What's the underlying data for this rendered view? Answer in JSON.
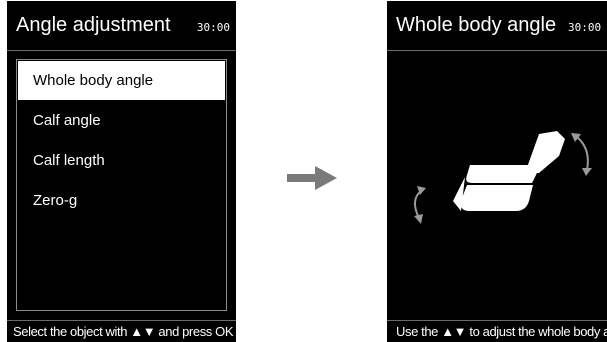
{
  "left_screen": {
    "title": "Angle adjustment",
    "time": "30:00",
    "menu_items": [
      {
        "label": "Whole body angle",
        "selected": true
      },
      {
        "label": "Calf angle",
        "selected": false
      },
      {
        "label": "Calf length",
        "selected": false
      },
      {
        "label": "Zero-g",
        "selected": false
      }
    ],
    "footer": "Select the object with ▲▼ and press OK"
  },
  "right_screen": {
    "title": "Whole body angle",
    "time": "30:00",
    "footer": "Use the ▲▼ to adjust the whole body angle"
  },
  "transition_arrow": {
    "icon": "right-arrow-icon",
    "color": "#7a7a7a"
  },
  "colors": {
    "screen_bg": "#000000",
    "text": "#ffffff",
    "selected_bg": "#ffffff",
    "selected_text": "#000000",
    "divider": "#6a6a6a",
    "rotation_arrow": "#9a9a9a"
  }
}
